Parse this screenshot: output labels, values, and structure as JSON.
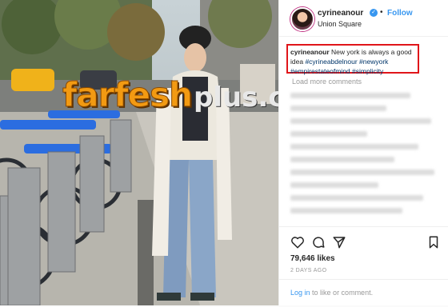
{
  "post": {
    "username": "cyrineanour",
    "follow_label": "Follow",
    "location": "Union Square",
    "separator": "•",
    "verified_mark": "✓",
    "caption": {
      "user": "cyrineanour",
      "text": "New york is always a good idea",
      "hashtags": [
        "#cyrineabdelnour",
        "#newyork",
        "#empirestateofmind",
        "#simplicity"
      ]
    },
    "load_more_label": "Load more comments",
    "likes": "79,646 likes",
    "time_ago": "2 DAYS AGO",
    "login_link": "Log in",
    "login_rest": "to like or comment.",
    "icons": [
      "heart-icon",
      "comment-icon",
      "share-icon",
      "bookmark-icon"
    ]
  },
  "watermark": {
    "main": "farfesh",
    "sub": "plus.com"
  },
  "colors": {
    "accent_blue": "#3897f0",
    "highlight_red": "#e0151a",
    "watermark_orange": "#f29a12"
  }
}
